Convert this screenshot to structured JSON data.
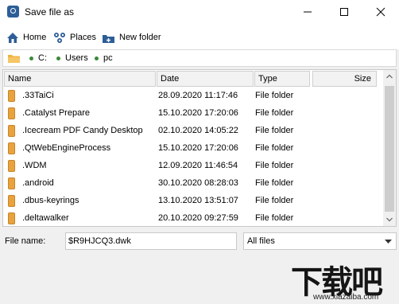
{
  "window": {
    "title": "Save file as"
  },
  "toolbar": {
    "home": "Home",
    "places": "Places",
    "new_folder": "New folder"
  },
  "path": [
    "C:",
    "Users",
    "pc"
  ],
  "columns": [
    "Name",
    "Date",
    "Type",
    "Size"
  ],
  "files": [
    {
      "name": ".33TaiCi",
      "date": "28.09.2020 11:17:46",
      "type": "File folder"
    },
    {
      "name": ".Catalyst Prepare",
      "date": "15.10.2020 17:20:06",
      "type": "File folder"
    },
    {
      "name": ".Icecream PDF Candy Desktop",
      "date": "02.10.2020 14:05:22",
      "type": "File folder"
    },
    {
      "name": ".QtWebEngineProcess",
      "date": "15.10.2020 17:20:06",
      "type": "File folder"
    },
    {
      "name": ".WDM",
      "date": "12.09.2020 11:46:54",
      "type": "File folder"
    },
    {
      "name": ".android",
      "date": "30.10.2020 08:28:03",
      "type": "File folder"
    },
    {
      "name": ".dbus-keyrings",
      "date": "13.10.2020 13:51:07",
      "type": "File folder"
    },
    {
      "name": ".deltawalker",
      "date": "20.10.2020 09:27:59",
      "type": "File folder"
    }
  ],
  "footer": {
    "file_name_label": "File name:",
    "file_name_value": "$R9HJCQ3.dwk",
    "filter_value": "All files"
  },
  "watermark": {
    "logo_text": "下载吧",
    "url": "www.xiazaiba.com"
  },
  "colors": {
    "accent": "#2d5e97",
    "folder": "#e9a33d",
    "path_dot": "#3a8a36"
  }
}
